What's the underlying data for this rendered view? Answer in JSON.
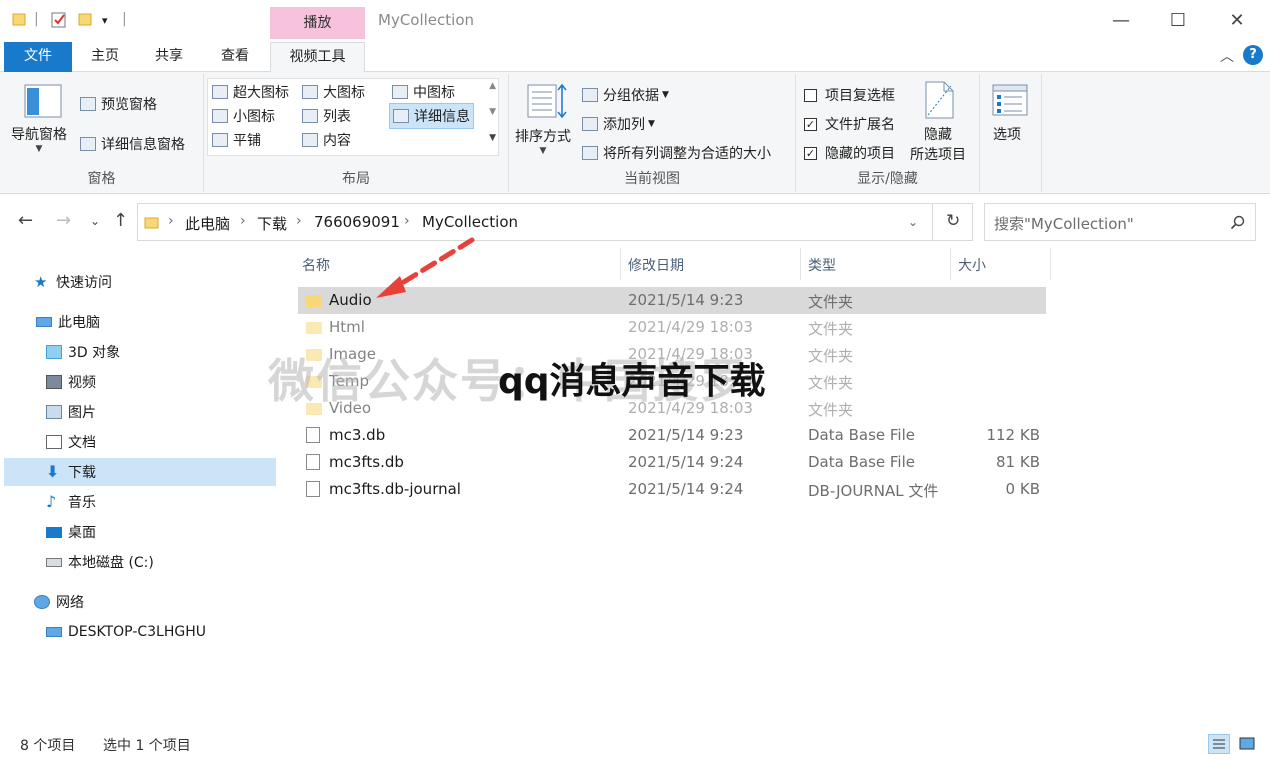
{
  "window": {
    "title": "MyCollection",
    "context_tab": "播放",
    "minimize": "—",
    "maximize": "☐",
    "close": "✕"
  },
  "ribbon_tabs": [
    "文件",
    "主页",
    "共享",
    "查看",
    "视频工具"
  ],
  "ribbon": {
    "panes": {
      "nav_pane": "导航窗格",
      "preview_pane": "预览窗格",
      "details_pane": "详细信息窗格",
      "label": "窗格"
    },
    "layout": {
      "items": [
        "超大图标",
        "大图标",
        "中图标",
        "小图标",
        "列表",
        "详细信息",
        "平铺",
        "内容"
      ],
      "label": "布局"
    },
    "current_view": {
      "sort": "排序方式",
      "group_by": "分组依据",
      "add_column": "添加列",
      "size_all": "将所有列调整为合适的大小",
      "label": "当前视图"
    },
    "show_hide": {
      "item_checkbox": "项目复选框",
      "file_ext": "文件扩展名",
      "hidden_items": "隐藏的项目",
      "hide_selected_1": "隐藏",
      "hide_selected_2": "所选项目",
      "label": "显示/隐藏",
      "item_checkbox_checked": false,
      "file_ext_checked": true,
      "hidden_items_checked": true
    },
    "options": "选项"
  },
  "address": {
    "crumbs": [
      "此电脑",
      "下载",
      "766069091",
      "MyCollection"
    ],
    "search_placeholder": "搜索\"MyCollection\""
  },
  "nav": {
    "quick_access": "快速访问",
    "this_pc": "此电脑",
    "objects3d": "3D 对象",
    "videos": "视频",
    "pictures": "图片",
    "documents": "文档",
    "downloads": "下载",
    "music": "音乐",
    "desktop": "桌面",
    "local_disk": "本地磁盘 (C:)",
    "network": "网络",
    "computer": "DESKTOP-C3LHGHU"
  },
  "columns": {
    "name": "名称",
    "modified": "修改日期",
    "type": "类型",
    "size": "大小"
  },
  "files": [
    {
      "name": "Audio",
      "modified": "2021/5/14 9:23",
      "type": "文件夹",
      "size": ""
    },
    {
      "name": "Html",
      "modified": "2021/4/29 18:03",
      "type": "文件夹",
      "size": ""
    },
    {
      "name": "Image",
      "modified": "2021/4/29 18:03",
      "type": "文件夹",
      "size": ""
    },
    {
      "name": "Temp",
      "modified": "2021/4/29 18:03",
      "type": "文件夹",
      "size": ""
    },
    {
      "name": "Video",
      "modified": "2021/4/29 18:03",
      "type": "文件夹",
      "size": ""
    },
    {
      "name": "mc3.db",
      "modified": "2021/5/14 9:23",
      "type": "Data Base File",
      "size": "112 KB"
    },
    {
      "name": "mc3fts.db",
      "modified": "2021/5/14 9:24",
      "type": "Data Base File",
      "size": "81 KB"
    },
    {
      "name": "mc3fts.db-journal",
      "modified": "2021/5/14 9:24",
      "type": "DB-JOURNAL 文件",
      "size": "0 KB"
    }
  ],
  "overlay": {
    "watermark": "微信公众号：中国搜罗",
    "headline": "qq消息声音下载"
  },
  "status": {
    "count": "8 个项目",
    "selected": "选中 1 个项目"
  },
  "colors": {
    "accent": "#1979ca",
    "context_tab": "#f7c3dc",
    "selection": "#cce4f7",
    "arrow": "#e8413a"
  }
}
